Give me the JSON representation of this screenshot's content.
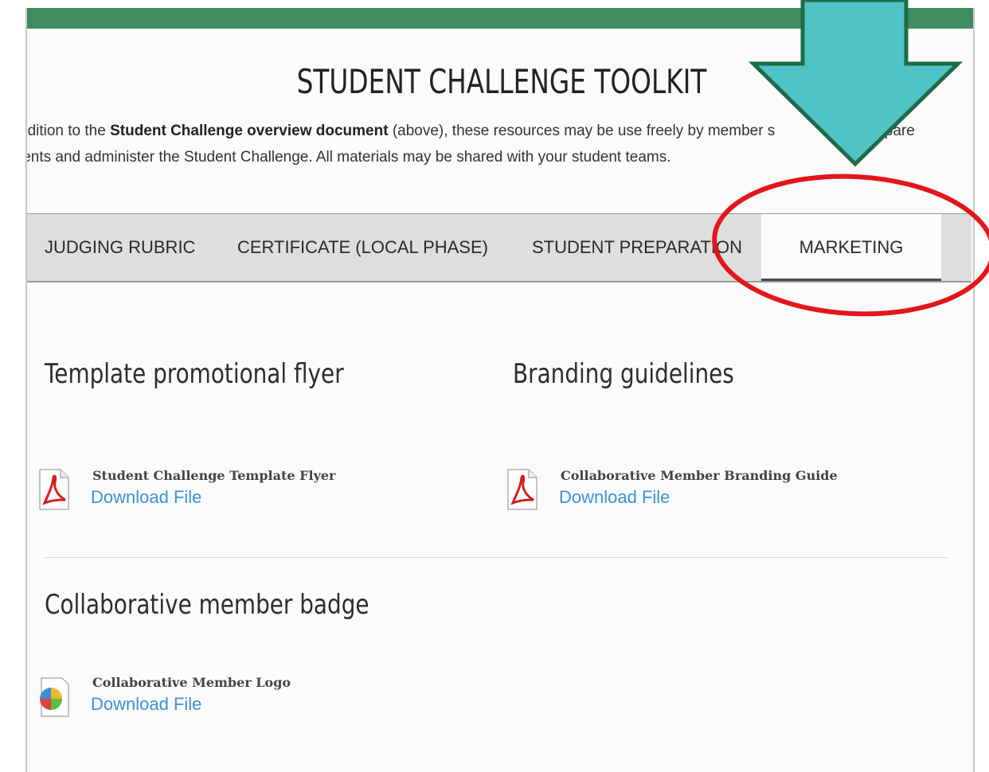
{
  "page": {
    "title": "STUDENT CHALLENGE TOOLKIT",
    "intro": {
      "line1_a": "ddition to the ",
      "line1_bold1": "Student Challenge overview document",
      "line1_b": " (above), these resources may be use freely by member s",
      "line1_c": "prepare",
      "line2": "lents and administer the Student Challenge.  All materials may be shared with your student teams."
    }
  },
  "tabs": [
    {
      "label": "JUDGING RUBRIC"
    },
    {
      "label": "CERTIFICATE  (LOCAL  PHASE)"
    },
    {
      "label": "STUDENT PREPARATION"
    },
    {
      "label": "MARKETING"
    }
  ],
  "sections": {
    "flyer": {
      "title": "Template promotional flyer",
      "file_name": "Student Challenge Template Flyer",
      "download": "Download File",
      "icon": "pdf-icon"
    },
    "branding": {
      "title": "Branding guidelines",
      "file_name": "Collaborative Member Branding Guide",
      "download": "Download File",
      "icon": "pdf-icon"
    },
    "badge": {
      "title": "Collaborative member badge",
      "file_name": "Collaborative Member Logo",
      "download": "Download File",
      "icon": "image-file-icon"
    }
  },
  "colors": {
    "topbar": "#3f8d5f",
    "arrow": "#4fc3c6",
    "arrow_border": "#1f6b45",
    "circle": "#e3161c",
    "link": "#3a93d6"
  }
}
